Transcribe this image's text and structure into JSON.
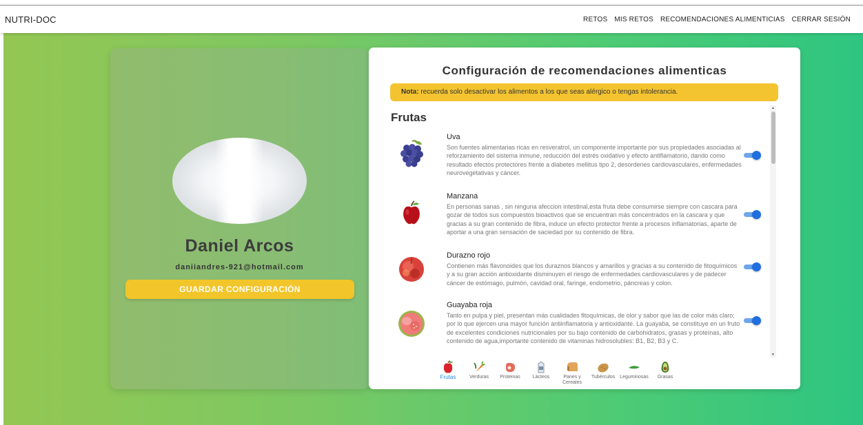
{
  "navbar": {
    "brand": "NUTRI-DOC",
    "links": [
      "RETOS",
      "MIS RETOS",
      "RECOMENDACIONES ALIMENTICIAS",
      "CERRAR SESIÓN"
    ]
  },
  "profile": {
    "name": "Daniel Arcos",
    "email": "daniiandres-921@hotmail.com",
    "save_button": "GUARDAR CONFIGURACIÓN"
  },
  "config": {
    "title": "Configuración de recomendaciones alimenticas",
    "note_label": "Nota:",
    "note_text": " recuerda solo desactivar los alimentos a los que seas alérgico o tengas intolerancia.",
    "section": "Frutas",
    "foods": [
      {
        "name": "Uva",
        "description": "Son fuentes alimentarias ricas en resveratrol, un componente importante por sus propiedades asociadas al reforzamiento del sistema inmune, reducción del estrés oxidativo y efecto antiflamatorio, dando como resultado efectos protectores frente a diabetes mellitus tipo 2, desordenes cardiovasculares, enfermedades neurovegetativas y cáncer.",
        "enabled": true,
        "icon": "grapes-icon"
      },
      {
        "name": "Manzana",
        "description": "En personas sanas , sin ninguna afeccion intestinal,esta fruta debe consumirse siempre con cascara para gozar de todos sus compuestos bioactivos que se encuentran más concentrados en la cascara y que gracias a su gran contenido de fibra, induce un efecto protector frente a procesos inflamatorias, aparte de aportar a una gran sensación de saciedad por su contenido de fibra.",
        "enabled": true,
        "icon": "apple-icon"
      },
      {
        "name": "Durazno rojo",
        "description": "Contienen más flavonoides que los duraznos blancos y amarillos y gracias a su contenido de fitoquímicos y a su gran acción antioxidante disminuyen el riesgo de enfermedades cardiovasculares y de padecer cáncer de estómago, pulmón, cavidad oral, faringe, endometrio, páncreas y colon.",
        "enabled": true,
        "icon": "peach-icon"
      },
      {
        "name": "Guayaba roja",
        "description": "Tanto en pulpa y piel, presentan más cualidades fitoquímicas, de olor y sabor que las de color más claro; por lo que ejercen una mayor función antiinflamatoria y antioxidante. La guayaba, se constituye en un fruto de excelentes condiciones nutricionales por su bajo contenido de carbohidratos, grasas y proteínas, alto contenido de agua,importante contenido de vitaminas hidrosolubles: B1, B2, B3 y C.",
        "enabled": true,
        "icon": "guava-icon"
      }
    ],
    "categories": [
      {
        "label": "Frutas",
        "icon": "apple-icon",
        "active": true
      },
      {
        "label": "Verduras",
        "icon": "carrot-icon",
        "active": false
      },
      {
        "label": "Proteinas",
        "icon": "meat-icon",
        "active": false
      },
      {
        "label": "Lácteos",
        "icon": "milk-carton-icon",
        "active": false
      },
      {
        "label": "Panes y Cereales",
        "icon": "bread-icon",
        "active": false
      },
      {
        "label": "Tubérculos",
        "icon": "potato-icon",
        "active": false
      },
      {
        "label": "Leguminosas",
        "icon": "bean-icon",
        "active": false
      },
      {
        "label": "Grasas",
        "icon": "avocado-icon",
        "active": false
      }
    ]
  },
  "colors": {
    "accent_yellow": "#f2c52a",
    "toggle_blue": "#1f6fe0",
    "active_category": "#1e88e5"
  }
}
